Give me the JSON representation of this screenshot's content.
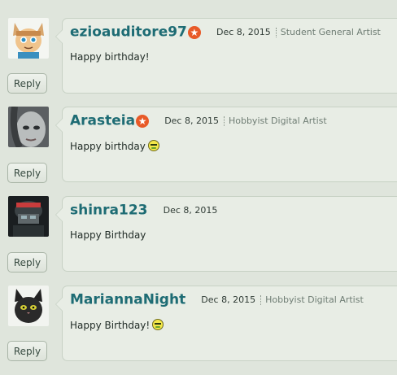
{
  "comments": [
    {
      "username": "ezioauditore97",
      "star_icon": "star-badge-icon",
      "date": "Dec 8, 2015",
      "rank": "Student General Artist",
      "text": "Happy birthday!",
      "reply_label": "Reply",
      "avatar_icon": "fox-avatar-icon"
    },
    {
      "username": "Arasteia",
      "star_icon": "star-badge-icon",
      "date": "Dec 8, 2015",
      "rank": "Hobbyist Digital Artist",
      "text": "Happy birthday",
      "smiley_icon": "smiley-icon",
      "reply_label": "Reply",
      "avatar_icon": "face-avatar-icon"
    },
    {
      "username": "shinra123",
      "date": "Dec 8, 2015",
      "text": "Happy Birthday",
      "reply_label": "Reply",
      "avatar_icon": "soldier-avatar-icon"
    },
    {
      "username": "MariannaNight",
      "date": "Dec 8, 2015",
      "rank": "Hobbyist Digital Artist",
      "text": "Happy Birthday!",
      "smiley_icon": "smiley-icon",
      "reply_label": "Reply",
      "avatar_icon": "cat-avatar-icon"
    }
  ],
  "colors": {
    "username": "#1e6c74",
    "badge": "#e85a28",
    "background": "#dfe5dc"
  }
}
